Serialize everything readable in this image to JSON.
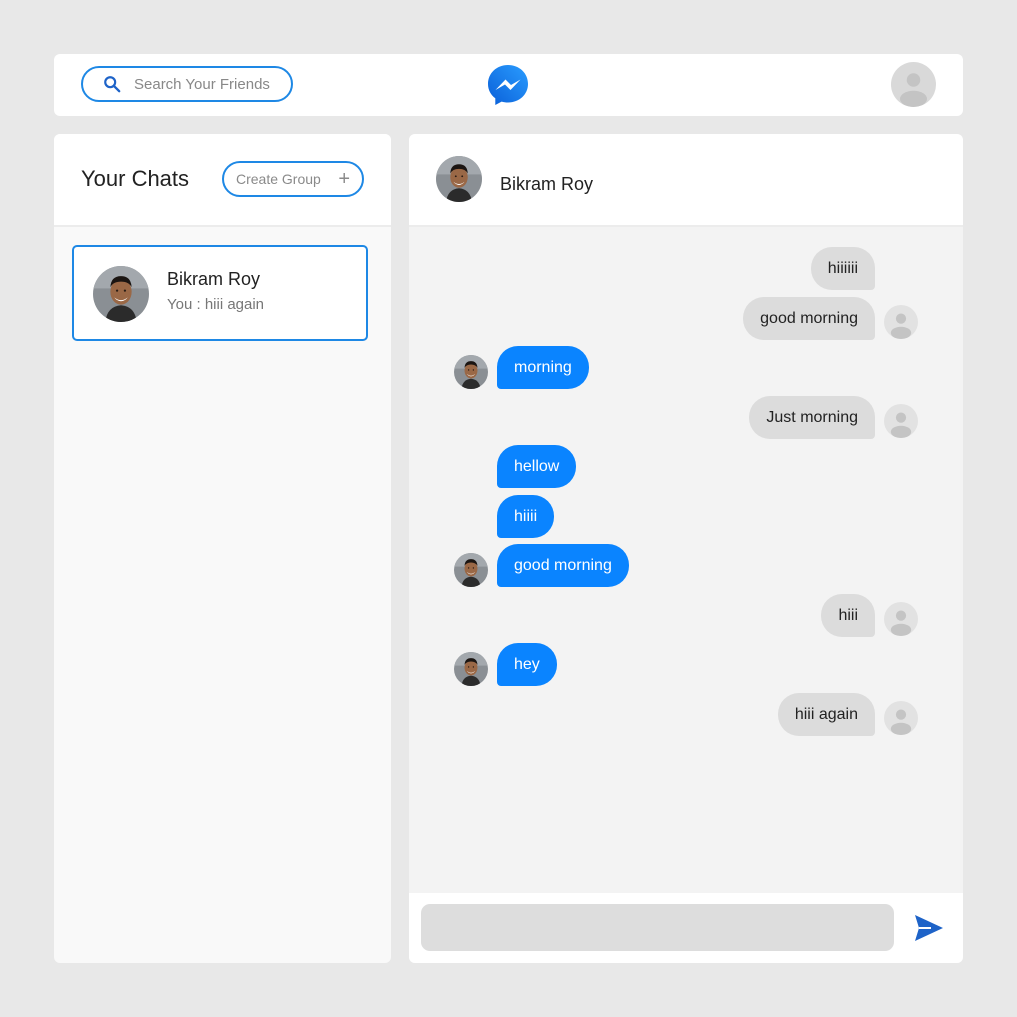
{
  "search": {
    "placeholder": "Search Your Friends"
  },
  "sidebar": {
    "title": "Your Chats",
    "create_group_label": "Create Group",
    "chats": [
      {
        "name": "Bikram Roy",
        "preview": "You : hiii again"
      }
    ]
  },
  "chat": {
    "contact_name": "Bikram Roy",
    "messages": [
      {
        "from": "me",
        "text": "hiiiiii"
      },
      {
        "from": "me",
        "text": "good morning"
      },
      {
        "from": "them",
        "text": "morning"
      },
      {
        "from": "me",
        "text": "Just morning"
      },
      {
        "from": "them",
        "text": "hellow"
      },
      {
        "from": "them",
        "text": "hiiii"
      },
      {
        "from": "them",
        "text": "good morning"
      },
      {
        "from": "me",
        "text": "hiii"
      },
      {
        "from": "them",
        "text": "hey"
      },
      {
        "from": "me",
        "text": "hiii again"
      }
    ],
    "composer_value": ""
  },
  "colors": {
    "accent": "#1e88e5",
    "incoming_bubble": "#0a84ff",
    "outgoing_bubble": "#dcdcdc",
    "background": "#e8e8e8"
  },
  "icons": [
    "search-icon",
    "messenger-logo-icon",
    "user-avatar-icon",
    "plus-icon",
    "send-icon"
  ]
}
